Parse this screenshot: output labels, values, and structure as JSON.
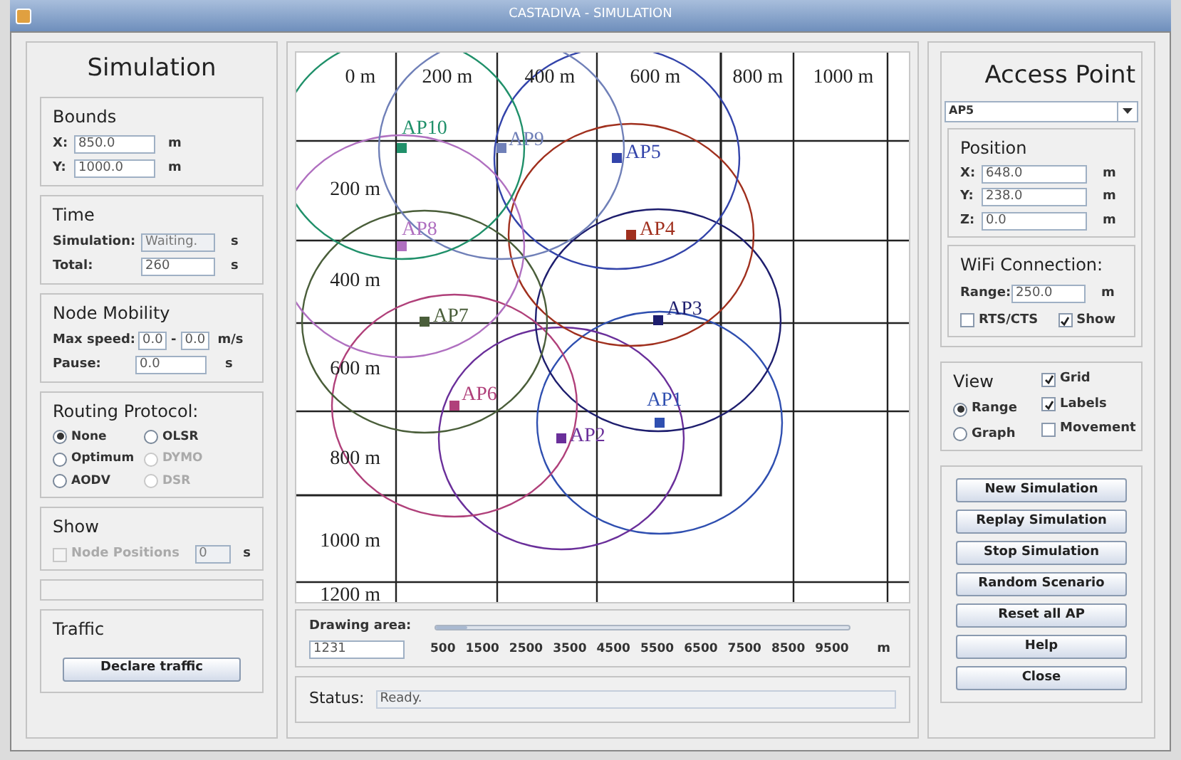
{
  "window": {
    "title": "CASTADIVA - SIMULATION"
  },
  "simulation": {
    "title": "Simulation",
    "bounds": {
      "title": "Bounds",
      "fields": [
        {
          "label": "X:",
          "value": "850.0",
          "unit": "m"
        },
        {
          "label": "Y:",
          "value": "1000.0",
          "unit": "m"
        }
      ]
    },
    "time": {
      "title": "Time",
      "fields": [
        {
          "label": "Simulation:",
          "value": "Waiting.",
          "unit": "s",
          "disabled": true
        },
        {
          "label": "Total:",
          "value": "260",
          "unit": "s",
          "disabled": false
        }
      ]
    },
    "mobility": {
      "title": "Node Mobility",
      "max_speed": {
        "label": "Max speed:",
        "from": "0.0",
        "separator": "-",
        "to": "0.0",
        "unit": "m/s"
      },
      "pause": {
        "label": "Pause:",
        "value": "0.0",
        "unit": "s"
      }
    },
    "routing": {
      "title": "Routing Protocol:",
      "options": [
        {
          "label": "None",
          "selected": true,
          "disabled": false
        },
        {
          "label": "OLSR",
          "selected": false,
          "disabled": false
        },
        {
          "label": "Optimum",
          "selected": false,
          "disabled": false
        },
        {
          "label": "DYMO",
          "selected": false,
          "disabled": true
        },
        {
          "label": "AODV",
          "selected": false,
          "disabled": false
        },
        {
          "label": "DSR",
          "selected": false,
          "disabled": true
        }
      ]
    },
    "show": {
      "title": "Show",
      "checkbox": {
        "label": "Node Positions",
        "checked": false,
        "disabled": true
      },
      "value": "0",
      "unit": "s"
    },
    "traffic": {
      "title": "Traffic",
      "button": "Declare traffic"
    }
  },
  "map": {
    "x_labels": [
      "0 m",
      "200 m",
      "400 m",
      "600 m",
      "800 m",
      "1000 m"
    ],
    "y_labels": [
      "200 m",
      "400 m",
      "600 m",
      "800 m",
      "1000 m",
      "1200 m"
    ],
    "access_points": [
      {
        "label": "AP1",
        "color": "#2f4fb0"
      },
      {
        "label": "AP2",
        "color": "#6a2f9a"
      },
      {
        "label": "AP3",
        "color": "#1e1e6e"
      },
      {
        "label": "AP4",
        "color": "#a0301e"
      },
      {
        "label": "AP5",
        "color": "#3344aa"
      },
      {
        "label": "AP6",
        "color": "#b0407a"
      },
      {
        "label": "AP7",
        "color": "#4a5e3a"
      },
      {
        "label": "AP8",
        "color": "#b070c0"
      },
      {
        "label": "AP9",
        "color": "#7080b8"
      },
      {
        "label": "AP10",
        "color": "#20906a"
      }
    ]
  },
  "drawing_area": {
    "label": "Drawing area:",
    "value": "1231",
    "level": 0.077,
    "ticks": [
      "500",
      "1500",
      "2500",
      "3500",
      "4500",
      "5500",
      "6500",
      "7500",
      "8500",
      "9500"
    ],
    "unit": "m"
  },
  "status": {
    "label": "Status:",
    "value": "Ready."
  },
  "access_point": {
    "title": "Access Point",
    "selector": "AP5",
    "position": {
      "title": "Position",
      "fields": [
        {
          "label": "X:",
          "value": "648.0",
          "unit": "m"
        },
        {
          "label": "Y:",
          "value": "238.0",
          "unit": "m"
        },
        {
          "label": "Z:",
          "value": "0.0",
          "unit": "m"
        }
      ]
    },
    "wifi": {
      "title": "WiFi Connection:",
      "range": {
        "label": "Range:",
        "value": "250.0",
        "unit": "m"
      },
      "checkboxes": [
        {
          "label": "RTS/CTS",
          "checked": false
        },
        {
          "label": "Show",
          "checked": true
        }
      ]
    }
  },
  "view": {
    "title": "View",
    "radios": [
      {
        "label": "Range",
        "selected": true
      },
      {
        "label": "Graph",
        "selected": false
      }
    ],
    "checkboxes": [
      {
        "label": "Grid",
        "checked": true
      },
      {
        "label": "Labels",
        "checked": true
      },
      {
        "label": "Movement",
        "checked": false
      }
    ]
  },
  "buttons": [
    "New Simulation",
    "Replay Simulation",
    "Stop Simulation",
    "Random Scenario",
    "Reset all AP",
    "Help",
    "Close"
  ]
}
